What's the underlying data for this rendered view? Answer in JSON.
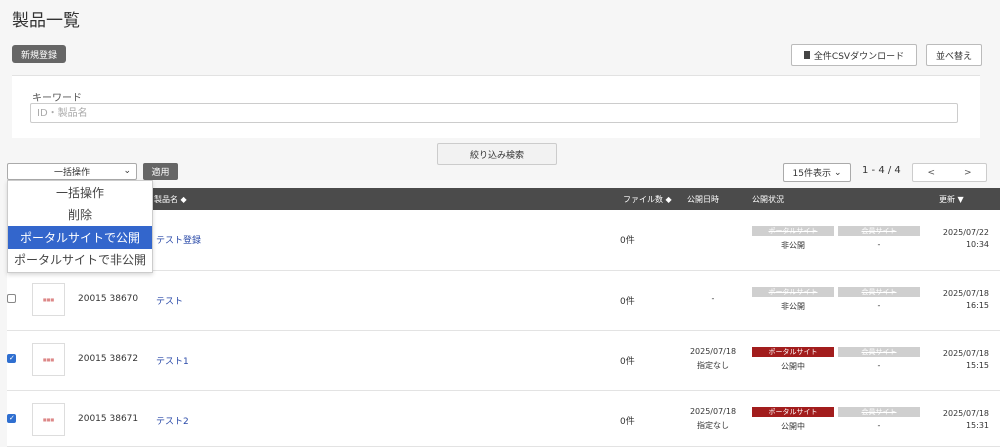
{
  "title": "製品一覧",
  "toolbar": {
    "new_label": "新規登録",
    "csv_label": "全件CSVダウンロード",
    "sort_label": "並べ替え"
  },
  "filter": {
    "keyword_label": "キーワード",
    "keyword_placeholder": "ID・製品名",
    "narrow_label": "絞り込み検索"
  },
  "bulk": {
    "selected": "一括操作",
    "apply_label": "適用",
    "options": [
      "一括操作",
      "削除",
      "ポータルサイトで公開",
      "ポータルサイトで非公開"
    ],
    "highlighted_index": 2
  },
  "pagination": {
    "per_page": "15件表示",
    "count": "1 - 4 / 4",
    "prev": "<",
    "next": ">"
  },
  "table": {
    "headers": {
      "name": "製品名 ◆",
      "files": "ファイル数 ◆",
      "pub_date": "公開日時",
      "pub_status": "公開状況",
      "updated": "更新 ▼"
    },
    "status_labels": {
      "portal": "ポータルサイト",
      "member": "会員サイト"
    },
    "rows": [
      {
        "id": "",
        "name": "テスト登録",
        "files": "0件",
        "pub_date": "",
        "pub_note": "",
        "portal_state": "非公開",
        "portal_on": false,
        "member_state": "-",
        "updated_date": "2025/07/22",
        "updated_time": "10:34",
        "checked": false
      },
      {
        "id": "20015 38670",
        "name": "テスト",
        "files": "0件",
        "pub_date": "-",
        "pub_note": "",
        "portal_state": "非公開",
        "portal_on": false,
        "member_state": "-",
        "updated_date": "2025/07/18",
        "updated_time": "16:15",
        "checked": false
      },
      {
        "id": "20015 38672",
        "name": "テスト1",
        "files": "0件",
        "pub_date": "2025/07/18",
        "pub_note": "指定なし",
        "portal_state": "公開中",
        "portal_on": true,
        "member_state": "-",
        "updated_date": "2025/07/18",
        "updated_time": "15:15",
        "checked": true
      },
      {
        "id": "20015 38671",
        "name": "テスト2",
        "files": "0件",
        "pub_date": "2025/07/18",
        "pub_note": "指定なし",
        "portal_state": "公開中",
        "portal_on": true,
        "member_state": "-",
        "updated_date": "2025/07/18",
        "updated_time": "15:31",
        "checked": true
      }
    ]
  },
  "icons": {
    "csv": "document-icon",
    "chevron": "chevron-down-icon"
  },
  "colors": {
    "header_bg": "#4b4b4b",
    "accent": "#3366cc",
    "public_tag": "#a21d1d",
    "link": "#2a4aa8"
  }
}
